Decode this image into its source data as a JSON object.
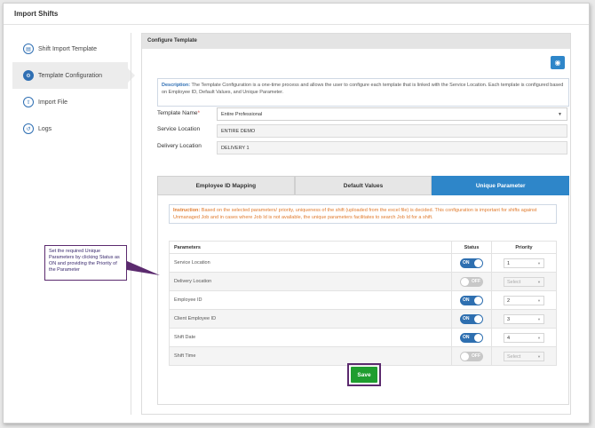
{
  "page": {
    "title": "Import Shifts"
  },
  "sidebar": {
    "items": [
      {
        "label": "Shift Import Template",
        "icon": "document-icon",
        "active": false
      },
      {
        "label": "Template Configuration",
        "icon": "gears-icon",
        "active": true
      },
      {
        "label": "Import File",
        "icon": "upload-icon",
        "active": false
      },
      {
        "label": "Logs",
        "icon": "history-icon",
        "active": false
      }
    ]
  },
  "panel": {
    "title": "Configure Template",
    "description_label": "Description:",
    "description_text": "The Template Configuration is a one-time process and allows the user to configure each template that is linked with the Service Location. Each template is configured based on Employee ID, Default Values, and Unique Parameter.",
    "template_name_label": "Template Name",
    "template_name_required": "*",
    "template_name_value": "Entire Professional",
    "service_location_label": "Service Location",
    "service_location_value": "ENTIRE DEMO",
    "delivery_location_label": "Delivery Location",
    "delivery_location_value": "DELIVERY 1"
  },
  "tabs": [
    {
      "label": "Employee ID Mapping",
      "active": false
    },
    {
      "label": "Default Values",
      "active": false
    },
    {
      "label": "Unique Parameter",
      "active": true
    }
  ],
  "instruction": {
    "label": "Instruction:",
    "text": "Based on the selected parameters/ priority, uniqueness of the shift (uploaded from the excel file) is decided. This configuration is important for shifts against Unmanaged Job and in cases where Job Id is not available, the unique parameters facilitates to search Job Id for a shift."
  },
  "table": {
    "headers": {
      "parameter": "Parameters",
      "status": "Status",
      "priority": "Priority"
    },
    "rows": [
      {
        "parameter": "Service Location",
        "status": "ON",
        "priority": "1"
      },
      {
        "parameter": "Delivery Location",
        "status": "OFF",
        "priority": "Select"
      },
      {
        "parameter": "Employee ID",
        "status": "ON",
        "priority": "2"
      },
      {
        "parameter": "Client Employee ID",
        "status": "ON",
        "priority": "3"
      },
      {
        "parameter": "Shift Date",
        "status": "ON",
        "priority": "4"
      },
      {
        "parameter": "Shift Time",
        "status": "OFF",
        "priority": "Select"
      }
    ]
  },
  "save_label": "Save",
  "callout": "Set the required Unique Parameters by clicking Status as ON and providing the Priority of the Parameter",
  "colors": {
    "accent": "#2e86c9",
    "toggle_on": "#2e6fb0",
    "save": "#1f9d2f",
    "callout_border": "#5b2a6e",
    "instruction": "#e07b2e"
  }
}
